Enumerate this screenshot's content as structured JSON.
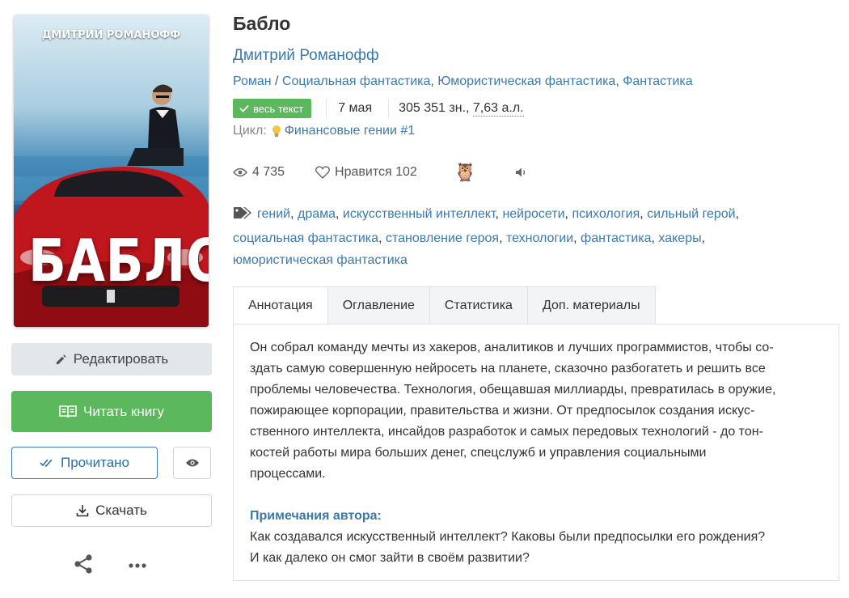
{
  "cover": {
    "author_text": "ДМИТРИЙ РОМАНОФФ",
    "title_text": "БАБЛО"
  },
  "actions": {
    "edit_label": "Редактировать",
    "read_label": "Читать книгу",
    "done_label": "Прочитано",
    "download_label": "Скачать"
  },
  "book": {
    "title": "Бабло",
    "author": "Дмитрий Романофф",
    "genres": [
      "Роман",
      "Социальная фантастика",
      "Юмористическая фантастика",
      "Фантастика"
    ],
    "full_text_badge": "весь текст",
    "date": "7 мая",
    "size_chars": "305 351 зн., ",
    "size_al": "7,63 а.л.",
    "cycle_label": "Цикл:",
    "cycle_name": "Финансовые гении #1"
  },
  "stats": {
    "views": "4 735",
    "likes_label": "Нравится 102"
  },
  "tags": [
    "гений",
    "драма",
    "искусственный интеллект",
    "нейросети",
    "психология",
    "сильный герой",
    "социальная фантастика",
    "становление героя",
    "технологии",
    "фантастика",
    "хакеры",
    "юмористическая фантастика"
  ],
  "tabs": [
    "Аннотация",
    "Оглавление",
    "Статистика",
    "Доп. материалы"
  ],
  "annotation": [
    "Он собрал команду мечты из хакеров, аналитиков и лучших программистов, чтобы со-",
    "здать самую совершенную нейросеть на планете, сказочно разбогатеть и решить все",
    "проблемы человечества. Технология, обещавшая миллиарды, превратилась в оружие,",
    "пожирающее корпорации, правительства и жизни. От предпосылок создания искус-",
    "ственного интеллекта, инсайдов разработок и самых передовых технологий - до тон-",
    "костей работы мира больших денег, спецслужб и управления социальными",
    "процессами."
  ],
  "notes": {
    "title": "Примечания автора:",
    "lines": [
      "Как создавался искусственный интеллект? Каковы были предпосылки его рождения?",
      "И как далеко он смог зайти в своём развитии?"
    ]
  },
  "colors": {
    "link": "#3a79ad",
    "success": "#5cb85c"
  }
}
